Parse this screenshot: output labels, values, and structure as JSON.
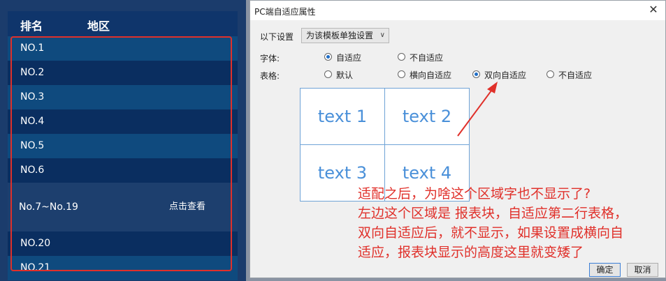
{
  "left_panel": {
    "header": {
      "col_rank": "排名",
      "col_region": "地区"
    },
    "rows": [
      {
        "label": "NO.1"
      },
      {
        "label": "NO.2"
      },
      {
        "label": "NO.3"
      },
      {
        "label": "NO.4"
      },
      {
        "label": "NO.5"
      },
      {
        "label": "NO.6"
      },
      {
        "label": "No.7~No.19",
        "link": "点击查看"
      },
      {
        "label": "NO.20"
      },
      {
        "label": "NO.21"
      }
    ]
  },
  "dialog": {
    "title": "PC端自适应属性",
    "close_icon": "close-icon",
    "settings_label": "以下设置",
    "settings_value": "为该模板单独设置",
    "font_label": "字体:",
    "font_options": [
      {
        "label": "自适应",
        "selected": true
      },
      {
        "label": "不自适应",
        "selected": false
      }
    ],
    "table_label": "表格:",
    "table_options": [
      {
        "label": "默认",
        "selected": false
      },
      {
        "label": "横向自适应",
        "selected": false
      },
      {
        "label": "双向自适应",
        "selected": true
      },
      {
        "label": "不自适应",
        "selected": false
      }
    ],
    "preview_cells": [
      "text 1",
      "text 2",
      "text 3",
      "text 4"
    ],
    "ok_label": "确定",
    "cancel_label": "取消"
  },
  "annotation": {
    "lines": [
      "适配之后，为啥这个区域字也不显示了?",
      "左边这个区域是 报表块，自适应第二行表格，",
      "双向自适应后，就不显示，如果设置成横向自",
      "适应，报表块显示的高度这里就变矮了"
    ],
    "color": "#e0302a"
  },
  "colors": {
    "panel_bg": "#1b3c6c",
    "row_light": "#0f4a7e",
    "row_dark": "#0a2e60",
    "accent_blue": "#4a90d9",
    "annotation_red": "#e0302a"
  }
}
